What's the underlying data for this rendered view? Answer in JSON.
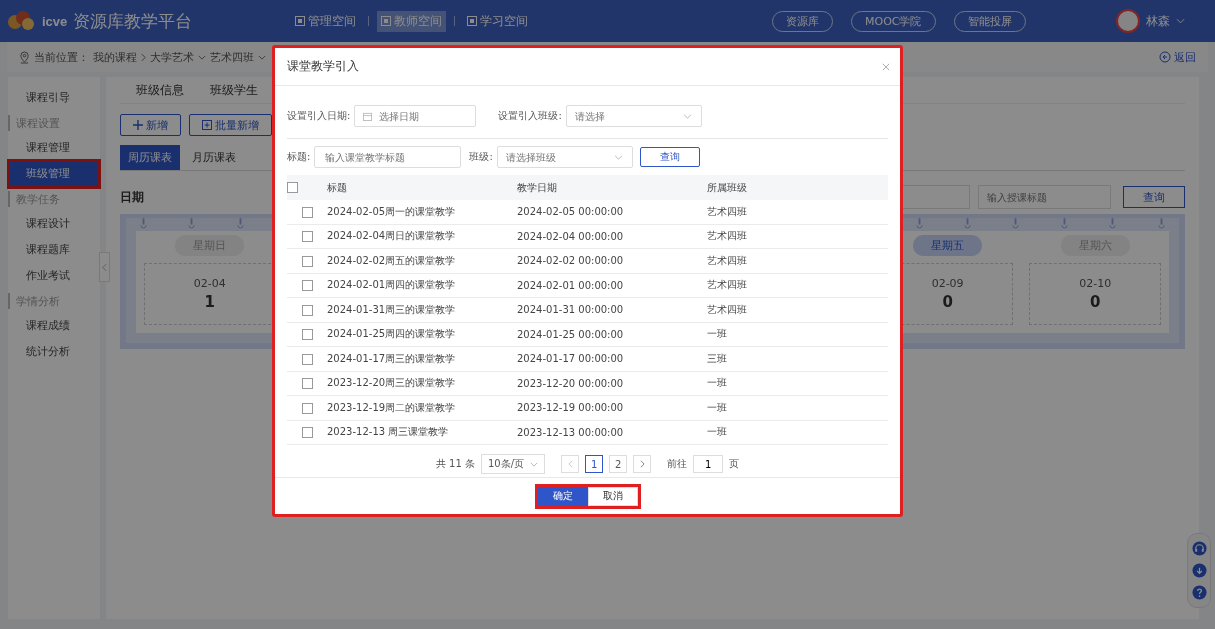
{
  "header": {
    "platform_name": "资源库教学平台",
    "logo_text": "icve",
    "spaces": [
      {
        "label": "管理空间",
        "selected": false
      },
      {
        "label": "教师空间",
        "selected": true
      },
      {
        "label": "学习空间",
        "selected": false
      }
    ],
    "links": [
      "资源库",
      "MOOC学院",
      "智能投屏"
    ],
    "user": {
      "name": "林森"
    }
  },
  "breadcrumb": {
    "label": "当前位置：",
    "crumbs": [
      {
        "text": "我的课程",
        "dropdown": false
      },
      {
        "text": "大学艺术",
        "dropdown": true
      },
      {
        "text": "艺术四班",
        "dropdown": true
      }
    ],
    "back": "返回"
  },
  "sidebar": {
    "items": [
      {
        "label": "课程引导",
        "kind": "item",
        "selected": false
      },
      {
        "label": "课程设置",
        "kind": "section"
      },
      {
        "label": "课程管理",
        "kind": "item",
        "selected": false
      },
      {
        "label": "班级管理",
        "kind": "item",
        "selected": true
      },
      {
        "label": "教学任务",
        "kind": "section"
      },
      {
        "label": "课程设计",
        "kind": "item",
        "selected": false
      },
      {
        "label": "课程题库",
        "kind": "item",
        "selected": false
      },
      {
        "label": "作业考试",
        "kind": "item",
        "selected": false
      },
      {
        "label": "学情分析",
        "kind": "section"
      },
      {
        "label": "课程成绩",
        "kind": "item",
        "selected": false
      },
      {
        "label": "统计分析",
        "kind": "item",
        "selected": false
      }
    ]
  },
  "content": {
    "tabs": [
      {
        "label": "班级信息",
        "selected": false
      },
      {
        "label": "班级学生",
        "selected": false
      }
    ],
    "actions": [
      "新增",
      "批量新增"
    ],
    "view_tabs": [
      {
        "label": "周历课表",
        "selected": true
      },
      {
        "label": "月历课表",
        "selected": false
      }
    ],
    "date_label": "日期",
    "filter": {
      "placeholder": "输入授课标题",
      "button": "查询"
    },
    "calendar": {
      "left_days": [
        {
          "weekday": "星期日",
          "date": "02-04",
          "count": "1",
          "selected": false
        }
      ],
      "right_days": [
        {
          "weekday": "星期五",
          "date": "02-09",
          "count": "0",
          "selected": true
        },
        {
          "weekday": "星期六",
          "date": "02-10",
          "count": "0",
          "selected": false
        }
      ]
    }
  },
  "dialog": {
    "title": "课堂教学引入",
    "date_field": {
      "label": "设置引入日期:",
      "placeholder": "选择日期"
    },
    "class_field": {
      "label": "设置引入班级:",
      "placeholder": "请选择"
    },
    "title_filter": {
      "label": "标题:",
      "placeholder": "输入课堂教学标题"
    },
    "class_filter": {
      "label": "班级:",
      "placeholder": "请选择班级"
    },
    "search_button": "查询",
    "table": {
      "all_checked": false,
      "columns": [
        "标题",
        "教学日期",
        "所属班级"
      ],
      "rows": [
        {
          "checked": false,
          "title": "2024-02-05周一的课堂教学",
          "date": "2024-02-05 00:00:00",
          "class": "艺术四班"
        },
        {
          "checked": false,
          "title": "2024-02-04周日的课堂教学",
          "date": "2024-02-04 00:00:00",
          "class": "艺术四班"
        },
        {
          "checked": false,
          "title": "2024-02-02周五的课堂教学",
          "date": "2024-02-02 00:00:00",
          "class": "艺术四班"
        },
        {
          "checked": false,
          "title": "2024-02-01周四的课堂教学",
          "date": "2024-02-01 00:00:00",
          "class": "艺术四班"
        },
        {
          "checked": false,
          "title": "2024-01-31周三的课堂教学",
          "date": "2024-01-31 00:00:00",
          "class": "艺术四班"
        },
        {
          "checked": false,
          "title": "2024-01-25周四的课堂教学",
          "date": "2024-01-25 00:00:00",
          "class": "一班"
        },
        {
          "checked": false,
          "title": "2024-01-17周三的课堂教学",
          "date": "2024-01-17 00:00:00",
          "class": "三班"
        },
        {
          "checked": false,
          "title": "2023-12-20周三的课堂教学",
          "date": "2023-12-20 00:00:00",
          "class": "一班"
        },
        {
          "checked": false,
          "title": "2023-12-19周二的课堂教学",
          "date": "2023-12-19 00:00:00",
          "class": "一班"
        },
        {
          "checked": false,
          "title": "2023-12-13 周三课堂教学",
          "date": "2023-12-13 00:00:00",
          "class": "一班"
        }
      ]
    },
    "pagination": {
      "total": "共 11 条",
      "page_size": "10条/页",
      "pages": [
        {
          "label": "1",
          "selected": true
        },
        {
          "label": "2",
          "selected": false
        }
      ],
      "goto_label": "前往",
      "goto_value": "1",
      "goto_unit": "页"
    },
    "confirm": "确定",
    "cancel": "取消"
  }
}
